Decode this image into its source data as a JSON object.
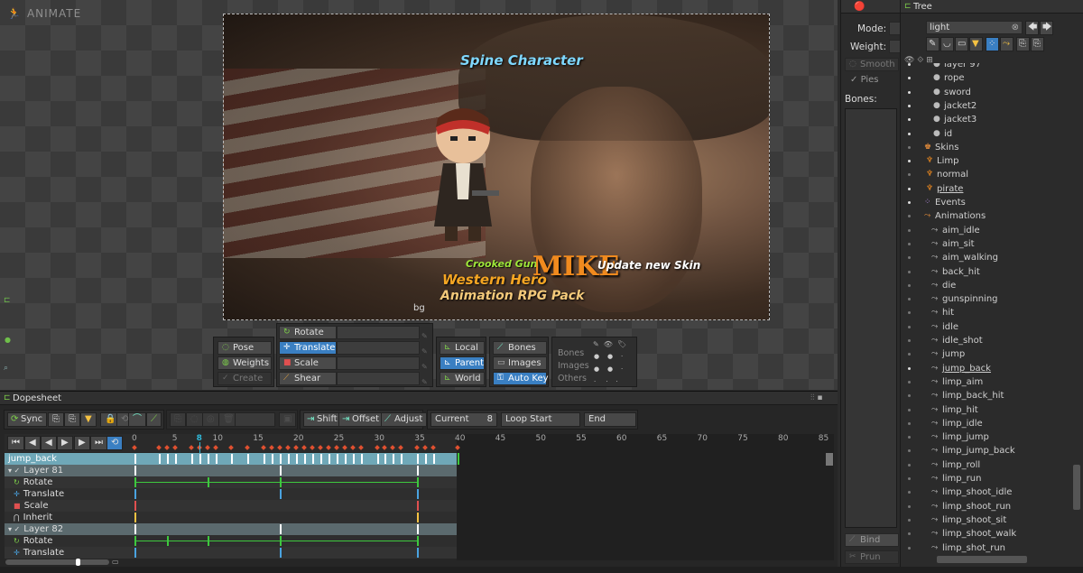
{
  "app": {
    "title": "ANIMATE"
  },
  "canvas": {
    "title": "Spine Character",
    "tag1": "Crooked Gun",
    "tag2": "MIKE",
    "tag3": "Update new Skin",
    "line1": "Western Hero",
    "line2": "Animation RPG Pack",
    "bg_label": "bg"
  },
  "tools": {
    "pose": "Pose",
    "weights": "Weights",
    "create": "Create",
    "rotate": "Rotate",
    "translate": "Translate",
    "scale": "Scale",
    "shear": "Shear",
    "local": "Local",
    "parent": "Parent",
    "world": "World",
    "bones": "Bones",
    "images": "Images",
    "autokey": "Auto Key",
    "vis_bones": "Bones",
    "vis_images": "Images",
    "vis_others": "Others"
  },
  "props": {
    "mode": "Mode:",
    "weight": "Weight:",
    "smooth": "Smooth",
    "pies": "Pies",
    "bones": "Bones:",
    "bind": "Bind",
    "prune": "Prun"
  },
  "tree": {
    "tab": "Tree",
    "search": "light",
    "items": [
      {
        "label": "layer 97"
      },
      {
        "label": "rope"
      },
      {
        "label": "sword"
      },
      {
        "label": "jacket2"
      },
      {
        "label": "jacket3"
      },
      {
        "label": "id"
      },
      {
        "label": "Skins"
      },
      {
        "label": "Limp"
      },
      {
        "label": "normal"
      },
      {
        "label": "pirate"
      },
      {
        "label": "Events"
      },
      {
        "label": "Animations"
      },
      {
        "label": "aim_idle"
      },
      {
        "label": "aim_sit"
      },
      {
        "label": "aim_walking"
      },
      {
        "label": "back_hit"
      },
      {
        "label": "die"
      },
      {
        "label": "gunspinning"
      },
      {
        "label": "hit"
      },
      {
        "label": "idle"
      },
      {
        "label": "idle_shot"
      },
      {
        "label": "jump"
      },
      {
        "label": "jump_back"
      },
      {
        "label": "limp_aim"
      },
      {
        "label": "limp_back_hit"
      },
      {
        "label": "limp_hit"
      },
      {
        "label": "limp_idle"
      },
      {
        "label": "limp_jump"
      },
      {
        "label": "limp_jump_back"
      },
      {
        "label": "limp_roll"
      },
      {
        "label": "limp_run"
      },
      {
        "label": "limp_shoot_idle"
      },
      {
        "label": "limp_shoot_run"
      },
      {
        "label": "limp_shoot_sit"
      },
      {
        "label": "limp_shoot_walk"
      },
      {
        "label": "limp_shot_run"
      }
    ]
  },
  "dopesheet": {
    "tab": "Dopesheet",
    "sync": "Sync",
    "shift": "Shift",
    "offset": "Offset",
    "adjust": "Adjust",
    "current_label": "Current",
    "current_value": "8",
    "loopstart": "Loop Start",
    "end": "End",
    "ruler": [
      "0",
      "5",
      "10",
      "15",
      "20",
      "25",
      "30",
      "35",
      "40",
      "45",
      "50",
      "55",
      "60",
      "65",
      "70",
      "75",
      "80",
      "85"
    ],
    "playhead": "8",
    "tracks": [
      {
        "name": "jump_back",
        "type": "anim"
      },
      {
        "name": "Layer 81",
        "type": "layer"
      },
      {
        "name": "Rotate",
        "type": "rotate"
      },
      {
        "name": "Translate",
        "type": "translate"
      },
      {
        "name": "Scale",
        "type": "scale"
      },
      {
        "name": "Inherit",
        "type": "inherit"
      },
      {
        "name": "Layer 82",
        "type": "layer"
      },
      {
        "name": "Rotate",
        "type": "rotate"
      },
      {
        "name": "Translate",
        "type": "translate"
      }
    ]
  }
}
